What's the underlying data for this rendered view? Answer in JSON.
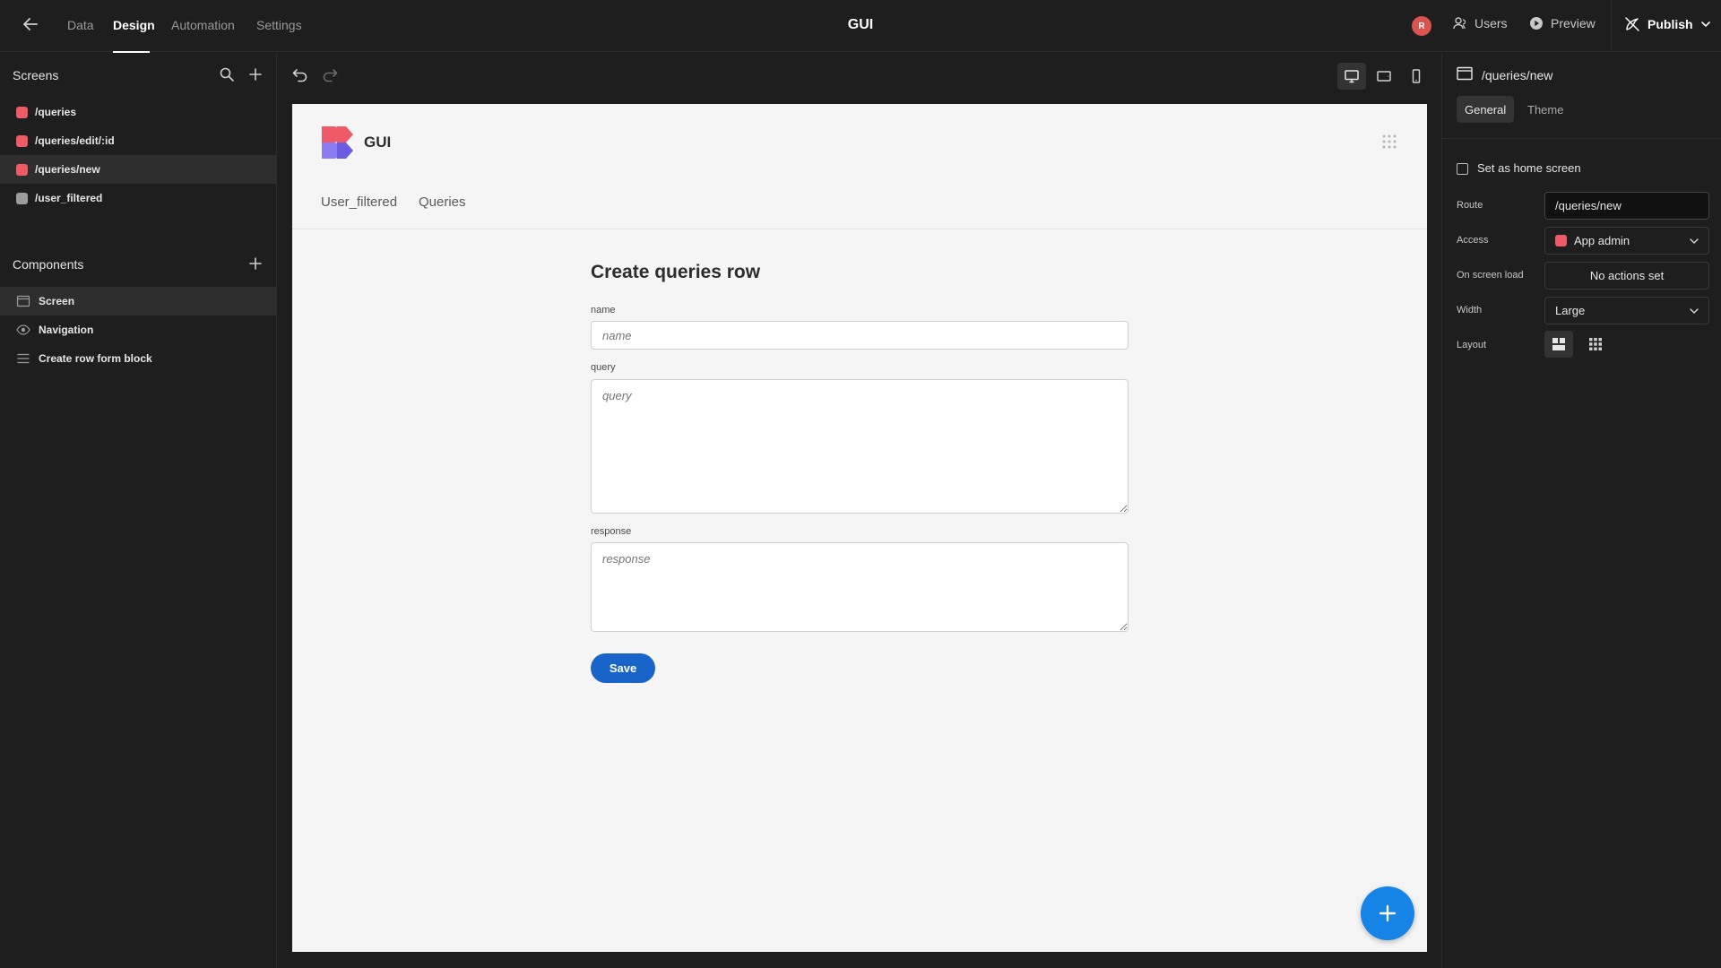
{
  "topbar": {
    "tabs": [
      "Data",
      "Design",
      "Automation",
      "Settings"
    ],
    "active_tab": "Design",
    "app_title": "GUI",
    "avatar_initial": "R",
    "users_label": "Users",
    "preview_label": "Preview",
    "publish_label": "Publish"
  },
  "sidebar": {
    "screens_title": "Screens",
    "screens": [
      {
        "route": "/queries",
        "color": "#ee5a66"
      },
      {
        "route": "/queries/edit/:id",
        "color": "#ee5a66"
      },
      {
        "route": "/queries/new",
        "color": "#ee5a66"
      },
      {
        "route": "/user_filtered",
        "color": "#9c9c9c"
      }
    ],
    "selected_screen": "/queries/new",
    "components_title": "Components",
    "components": [
      {
        "label": "Screen",
        "icon": "screen-icon"
      },
      {
        "label": "Navigation",
        "icon": "eye-icon"
      },
      {
        "label": "Create row form block",
        "icon": "form-icon"
      }
    ],
    "selected_component": "Screen"
  },
  "canvas": {
    "app_name": "GUI",
    "nav_links": [
      "User_filtered",
      "Queries"
    ],
    "form_title": "Create queries row",
    "fields": [
      {
        "label": "name",
        "placeholder": "name"
      },
      {
        "label": "query",
        "placeholder": "query"
      },
      {
        "label": "response",
        "placeholder": "response"
      }
    ],
    "save_label": "Save",
    "fab_label": "+"
  },
  "right_panel": {
    "title": "/queries/new",
    "tabs": [
      "General",
      "Theme"
    ],
    "active_tab": "General",
    "home_screen_label": "Set as home screen",
    "route_label": "Route",
    "route_value": "/queries/new",
    "access_label": "Access",
    "access_value": "App admin",
    "on_load_label": "On screen load",
    "on_load_value": "No actions set",
    "width_label": "Width",
    "width_value": "Large",
    "layout_label": "Layout"
  },
  "colors": {
    "accent": "#1864c8",
    "fab": "#1584e6",
    "admin_role": "#ee5a66",
    "basic_role": "#9c9c9c"
  }
}
